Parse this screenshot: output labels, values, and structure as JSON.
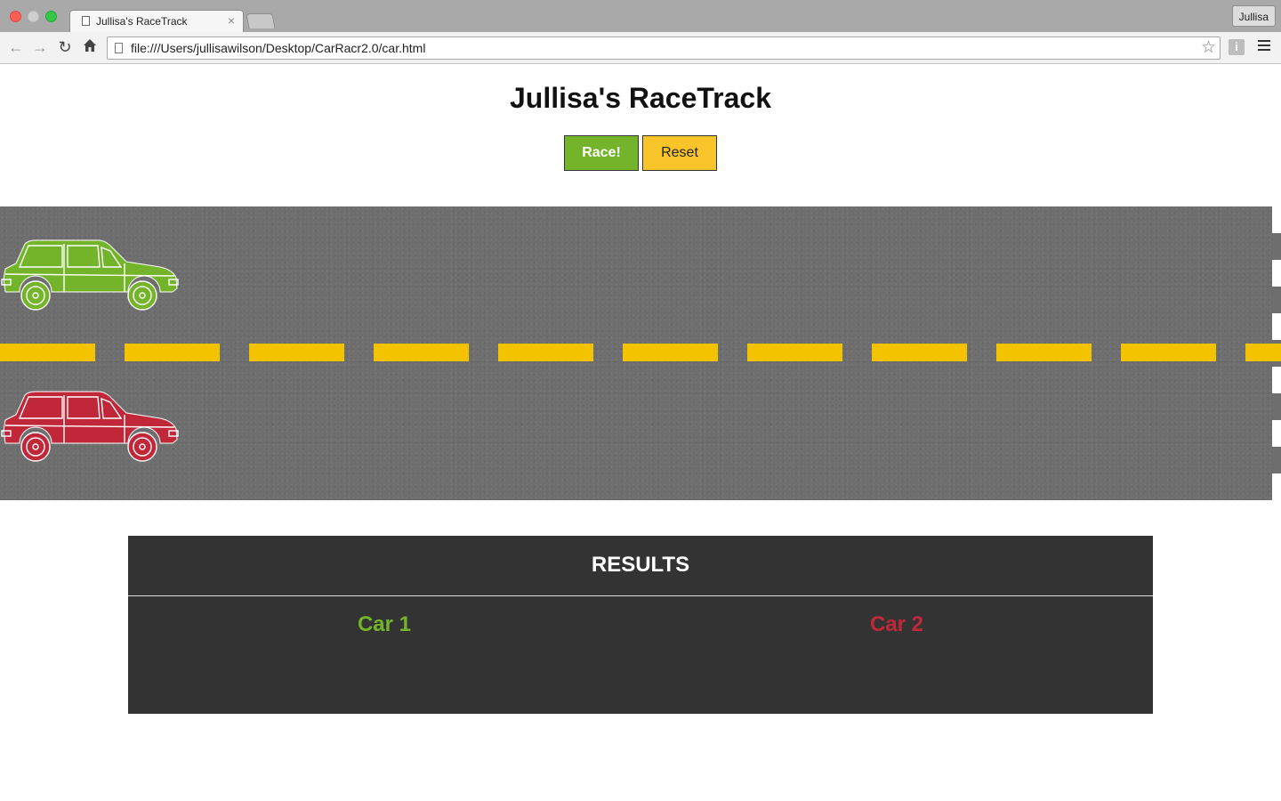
{
  "browser": {
    "tab_title": "Jullisa's RaceTrack",
    "tab_close": "×",
    "profile_name": "Jullisa",
    "url": "file:///Users/jullisawilson/Desktop/CarRacr2.0/car.html"
  },
  "page": {
    "title": "Jullisa's RaceTrack",
    "race_button": "Race!",
    "reset_button": "Reset"
  },
  "track": {
    "asphalt_color": "#6e6e6e",
    "lane_line_color": "#f3c300",
    "cars": [
      {
        "name": "car-1",
        "color": "#74b42a",
        "position": 0
      },
      {
        "name": "car-2",
        "color": "#c0283a",
        "position": 0
      }
    ]
  },
  "results": {
    "title": "RESULTS",
    "car1_label": "Car 1",
    "car2_label": "Car 2",
    "car1_color": "#74b42a",
    "car2_color": "#c0283a"
  },
  "icons": {
    "back": "back-arrow-icon",
    "forward": "forward-arrow-icon",
    "reload": "reload-icon",
    "home": "home-icon",
    "bookmark": "star-icon",
    "info": "info-icon",
    "menu": "hamburger-menu-icon"
  }
}
